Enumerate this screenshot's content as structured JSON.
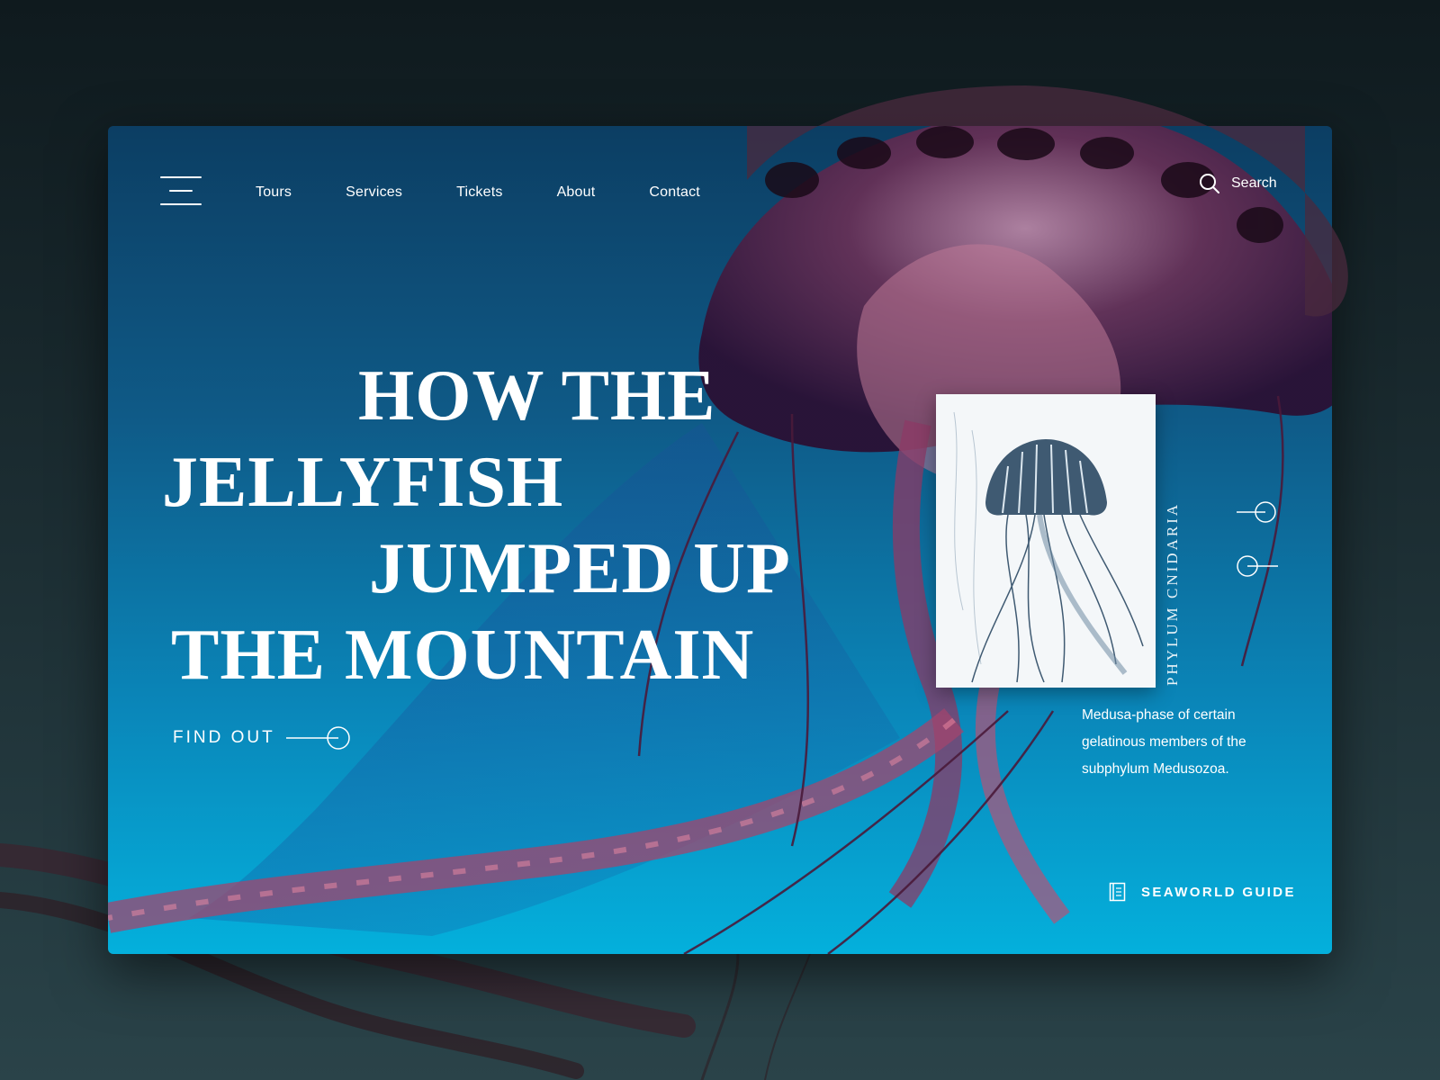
{
  "nav": {
    "menu_icon": "hamburger-menu-icon",
    "items": [
      {
        "label": "Tours"
      },
      {
        "label": "Services"
      },
      {
        "label": "Tickets"
      },
      {
        "label": "About"
      },
      {
        "label": "Contact"
      }
    ]
  },
  "search": {
    "icon": "search-icon",
    "label": "Search"
  },
  "hero": {
    "headline_lines": [
      "HOW THE",
      "JELLYFISH",
      "JUMPED UP",
      "THE MOUNTAIN"
    ],
    "cta_label": "FIND OUT",
    "cta_icon": "arrow-circle-icon"
  },
  "feature": {
    "vertical_caption": "PHYLUM CNIDARIA",
    "description": "Medusa-phase of certain gelatinous members of the subphylum Medusozoa.",
    "slider_icons": [
      "next-slide-icon",
      "previous-slide-icon"
    ]
  },
  "guide": {
    "icon": "book-icon",
    "label": "SEAWORLD GUIDE"
  },
  "colors": {
    "page_background": "#16252a",
    "card_top": "#0c3e63",
    "card_bottom": "#04b0dc",
    "jellyfish_body": "#6a2f55",
    "jellyfish_accent": "#c45a78",
    "text": "#ffffff"
  }
}
